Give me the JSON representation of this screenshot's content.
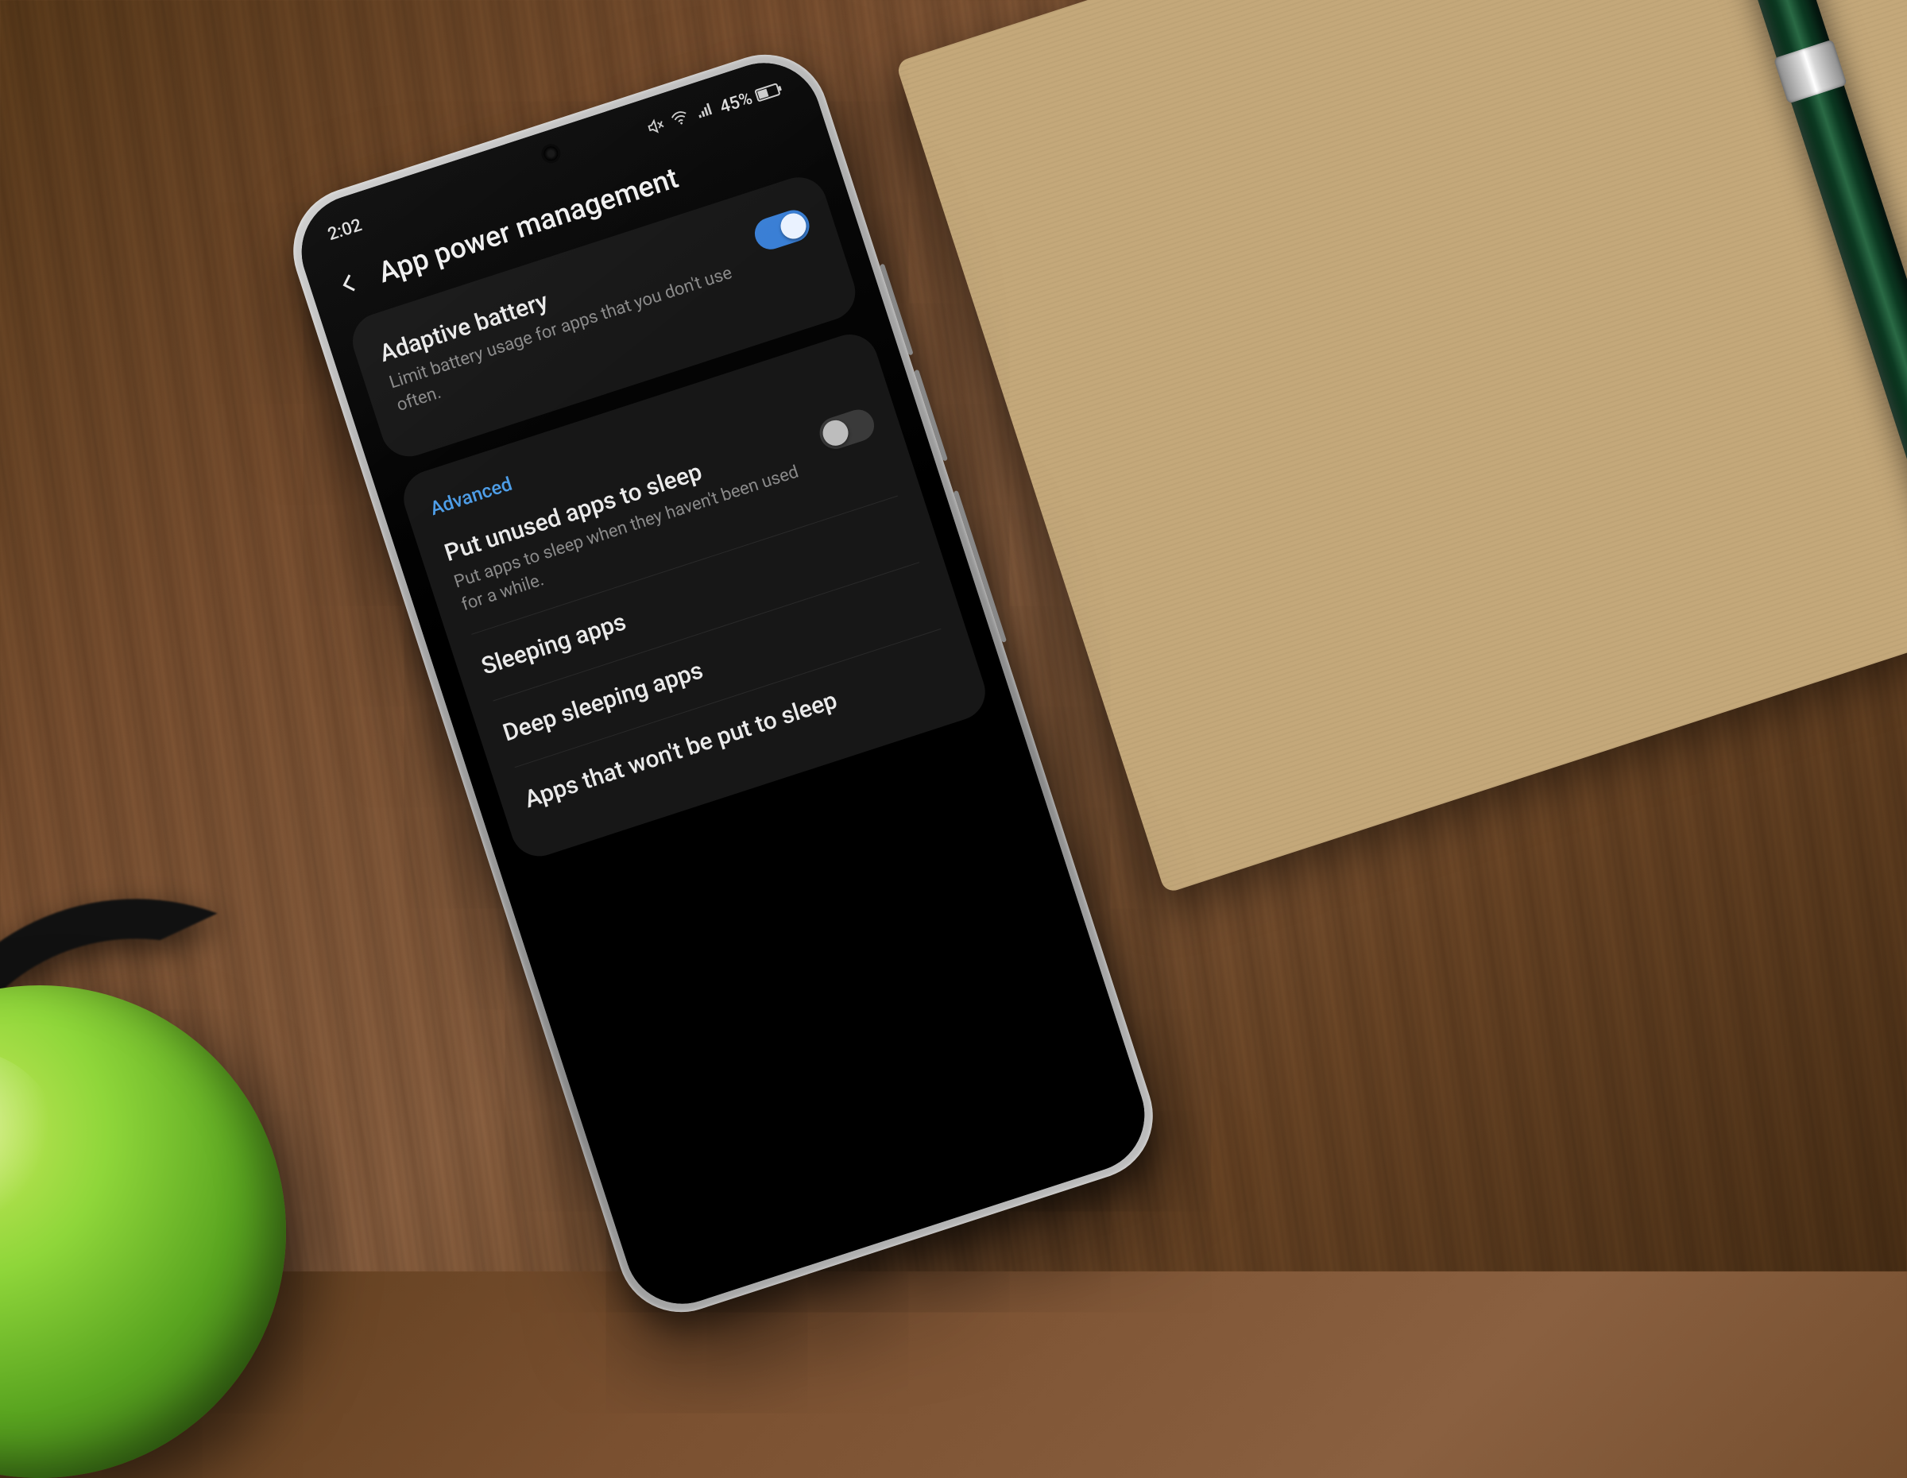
{
  "status": {
    "time": "2:02",
    "battery_pct": "45%"
  },
  "header": {
    "title": "App power management"
  },
  "adaptive": {
    "title": "Adaptive battery",
    "desc": "Limit battery usage for apps that you don't use often.",
    "on": true
  },
  "advanced": {
    "label": "Advanced",
    "unused": {
      "title": "Put unused apps to sleep",
      "desc": "Put apps to sleep when they haven't been used for a while.",
      "on": false
    },
    "rows": {
      "sleeping": "Sleeping apps",
      "deep": "Deep sleeping apps",
      "never": "Apps that won't be put to sleep"
    }
  }
}
